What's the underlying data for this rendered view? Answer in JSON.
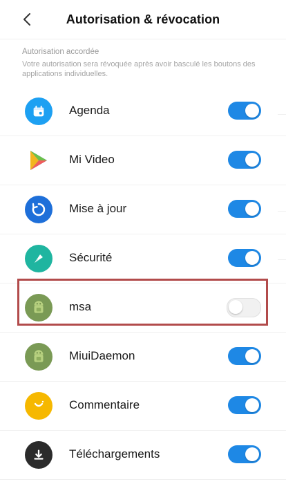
{
  "header": {
    "title": "Autorisation & révocation",
    "back_icon": "chevron-left-icon"
  },
  "section": {
    "title": "Autorisation accordée",
    "description": "Votre autorisation sera révoquée après avoir basculé les boutons des applications individuelles."
  },
  "apps": [
    {
      "label": "Agenda",
      "enabled": true,
      "icon": "calendar-icon",
      "color": "#1da0f2"
    },
    {
      "label": "Mi Video",
      "enabled": true,
      "icon": "play-icon",
      "color": "#6cc04a"
    },
    {
      "label": "Mise à jour",
      "enabled": true,
      "icon": "update-icon",
      "color": "#1e6fd9"
    },
    {
      "label": "Sécurité",
      "enabled": true,
      "icon": "security-icon",
      "color": "#1fb5a0"
    },
    {
      "label": "msa",
      "enabled": false,
      "icon": "android-icon",
      "color": "#7a9a55"
    },
    {
      "label": "MiuiDaemon",
      "enabled": true,
      "icon": "android-icon",
      "color": "#7a9a55"
    },
    {
      "label": "Commentaire",
      "enabled": true,
      "icon": "feedback-icon",
      "color": "#f6b800"
    },
    {
      "label": "Téléchargements",
      "enabled": true,
      "icon": "download-icon",
      "color": "#2b2b2b"
    }
  ],
  "colors": {
    "accent": "#1e88e5",
    "highlight": "#b24b4b"
  }
}
